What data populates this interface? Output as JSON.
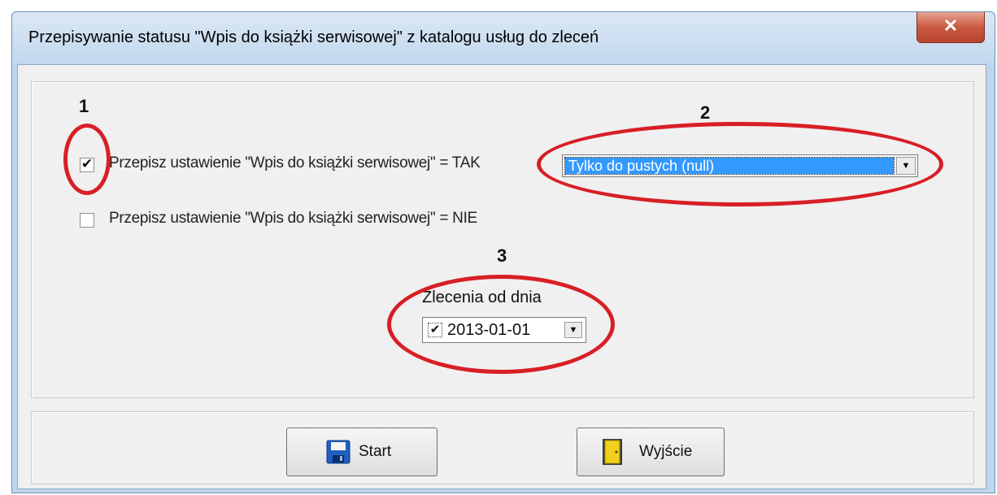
{
  "window": {
    "title": "Przepisywanie statusu \"Wpis do książki serwisowej\" z katalogu usług do zleceń",
    "close_icon": "close-icon"
  },
  "options": {
    "yes": {
      "label": "Przepisz ustawienie \"Wpis do książki serwisowej\" = TAK",
      "checked": true
    },
    "no": {
      "label": "Przepisz ustawienie \"Wpis do książki serwisowej\" = NIE",
      "checked": false
    }
  },
  "mode_select": {
    "value": "Tylko do pustych (null)"
  },
  "date": {
    "label": "Zlecenia od dnia",
    "value": "2013-01-01",
    "enabled": true
  },
  "buttons": {
    "start": "Start",
    "exit": "Wyjście"
  },
  "annotations": [
    "1",
    "2",
    "3"
  ],
  "colors": {
    "annotation": "#d81f26",
    "selection": "#3399ff"
  }
}
